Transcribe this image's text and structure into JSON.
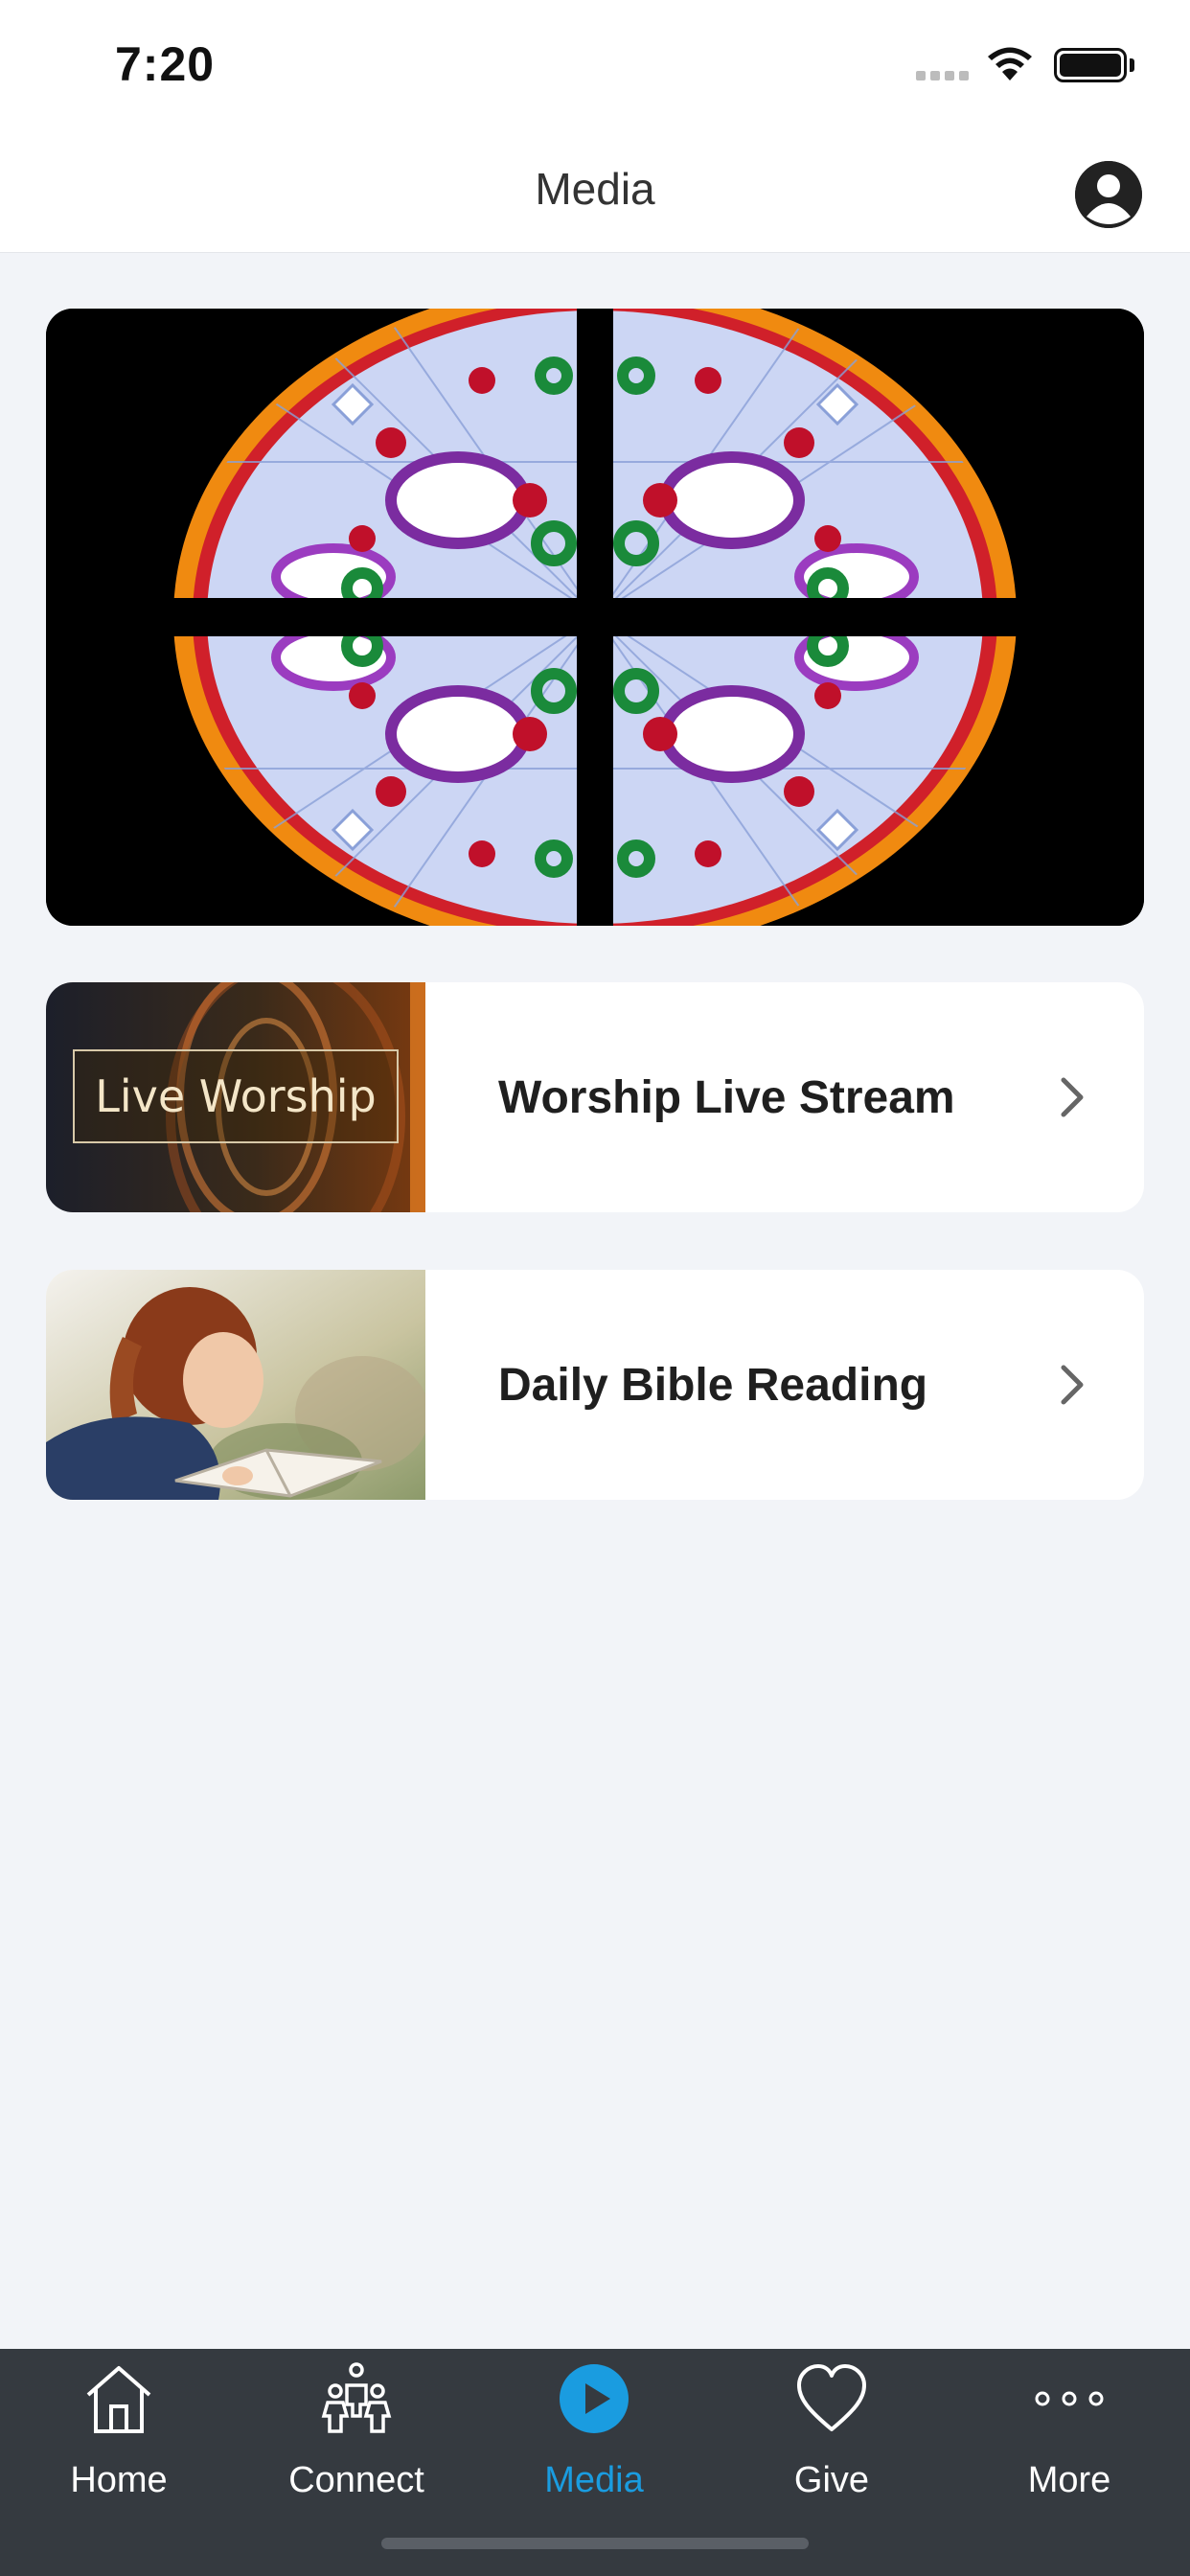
{
  "status_bar": {
    "time": "7:20"
  },
  "header": {
    "title": "Media",
    "profile_icon": "person-circle-icon"
  },
  "hero": {
    "image": "stained-glass-rose-window"
  },
  "media_items": [
    {
      "thumbnail_text": "Live Worship",
      "title": "Worship Live Stream",
      "icon": "chevron-right-icon"
    },
    {
      "thumbnail_image": "girl-reading-bible",
      "title": "Daily Bible Reading",
      "icon": "chevron-right-icon"
    }
  ],
  "tab_bar": {
    "active": "Media",
    "tabs": [
      {
        "label": "Home",
        "icon": "home-icon"
      },
      {
        "label": "Connect",
        "icon": "people-icon"
      },
      {
        "label": "Media",
        "icon": "play-circle-icon"
      },
      {
        "label": "Give",
        "icon": "heart-icon"
      },
      {
        "label": "More",
        "icon": "more-dots-icon"
      }
    ]
  },
  "colors": {
    "accent": "#1a9ce0",
    "tab_bar_bg": "#353a40",
    "page_bg": "#f2f4f8"
  }
}
